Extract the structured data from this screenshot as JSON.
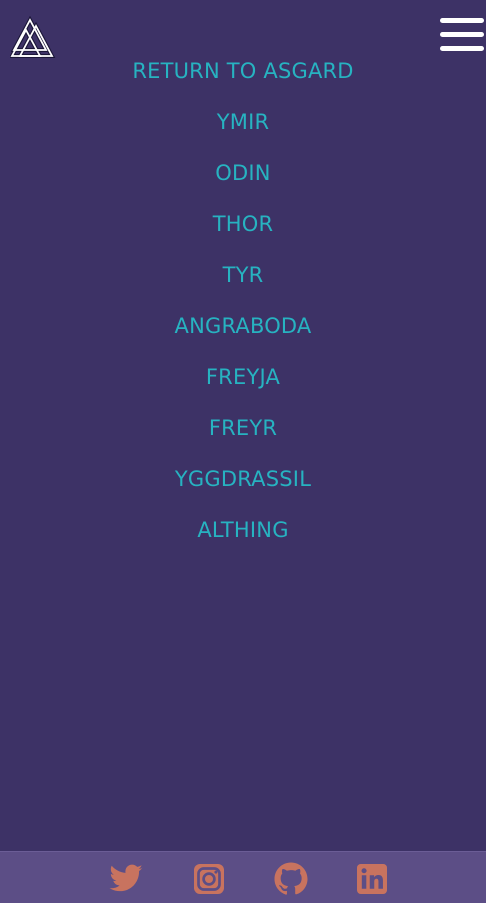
{
  "header": {
    "logo_icon": "valknut-icon",
    "menu_icon": "hamburger-menu-icon"
  },
  "nav": {
    "items": [
      {
        "label": "RETURN TO ASGARD"
      },
      {
        "label": "YMIR"
      },
      {
        "label": "ODIN"
      },
      {
        "label": "THOR"
      },
      {
        "label": "TYR"
      },
      {
        "label": "ANGRABODA"
      },
      {
        "label": "FREYJA"
      },
      {
        "label": "FREYR"
      },
      {
        "label": "YGGDRASSIL"
      },
      {
        "label": "ALTHING"
      }
    ]
  },
  "footer": {
    "icons": [
      "twitter-icon",
      "instagram-icon",
      "github-icon",
      "linkedin-icon"
    ]
  },
  "colors": {
    "background": "#3d3266",
    "link": "#27b3c1",
    "footer_bg": "#5c4e86",
    "social_icon": "#c8735f",
    "menu_bars": "#ffffff"
  }
}
